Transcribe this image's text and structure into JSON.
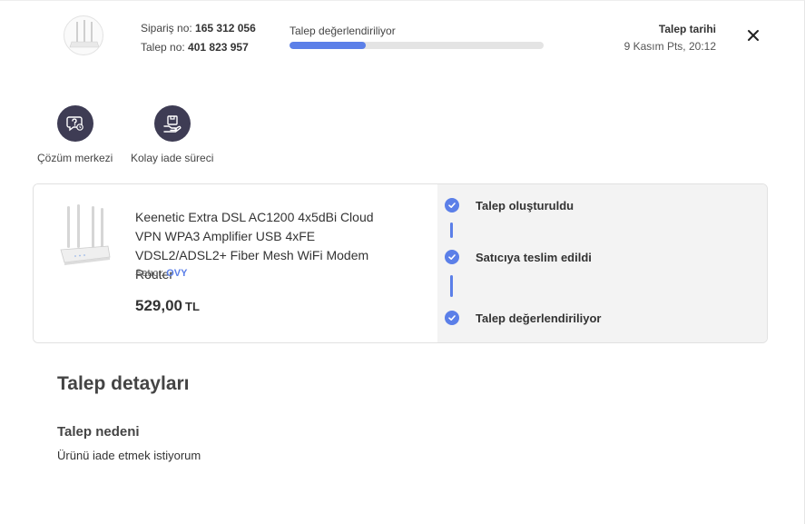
{
  "header": {
    "order_label": "Sipariş no:",
    "order_no": "165 312 056",
    "request_label": "Talep no:",
    "request_no": "401 823 957",
    "progress_label": "Talep değerlendiriliyor",
    "progress_fraction": 0.3,
    "date_title": "Talep tarihi",
    "date_value": "9 Kasım Pts, 20:12",
    "close_icon": "close-icon"
  },
  "actions": [
    {
      "label": "Çözüm merkezi",
      "icon": "chat-question-icon"
    },
    {
      "label": "Kolay iade süreci",
      "icon": "package-return-icon"
    }
  ],
  "product": {
    "name": "Keenetic Extra DSL AC1200 4x5dBi Cloud VPN WPA3 Amplifier USB 4xFE VDSL2/ADSL2+ Fiber Mesh WiFi Modem Router",
    "seller_label": "Satıcı:",
    "seller_name": "OVY",
    "price": "529,00",
    "currency": "TL"
  },
  "steps": [
    {
      "label": "Talep oluşturuldu"
    },
    {
      "label": "Satıcıya teslim edildi"
    },
    {
      "label": "Talep değerlendiriliyor"
    }
  ],
  "details": {
    "title": "Talep detayları",
    "reason_title": "Talep nedeni",
    "reason_value": "Ürünü iade etmek istiyorum"
  },
  "colors": {
    "accent": "#5b7fe8",
    "action_circle": "#3e3c54",
    "panel_bg": "#f3f3f3"
  }
}
